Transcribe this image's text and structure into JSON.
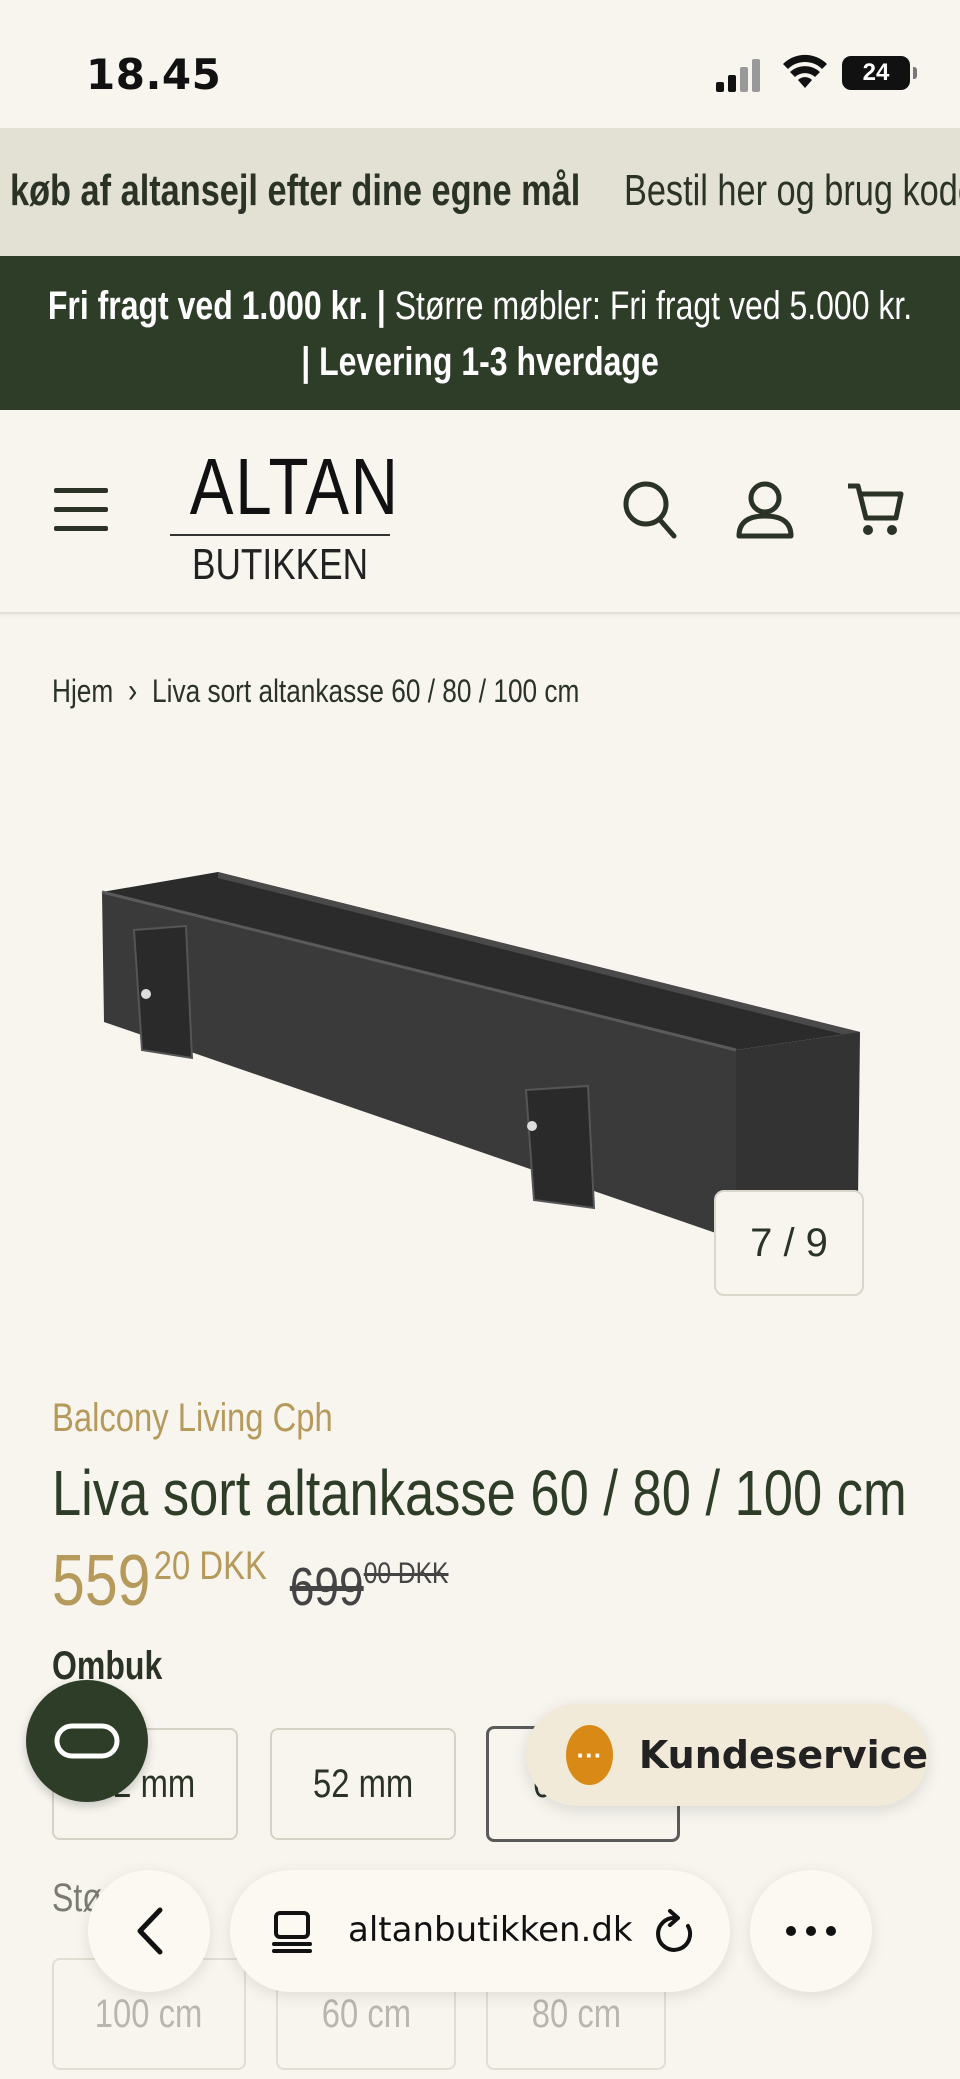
{
  "status_bar": {
    "time": "18.45",
    "battery": "24"
  },
  "announcement": {
    "text_bold": "køb af altansejl efter dine egne mål",
    "text_regular": "Bestil her og brug kode"
  },
  "shipping": {
    "part1": "Fri fragt ved 1.000 kr. |",
    "part2": " Større møbler: Fri fragt ved 5.000 kr.",
    "part3": "| Levering 1-3 hverdage"
  },
  "header": {
    "logo_top": "ALTAN",
    "logo_bottom": "BUTIKKEN",
    "icons": [
      "menu-icon",
      "search-icon",
      "account-icon",
      "cart-icon"
    ]
  },
  "breadcrumb": {
    "home": "Hjem",
    "current": "Liva sort altankasse 60 / 80 / 100 cm"
  },
  "gallery": {
    "counter": "7 / 9"
  },
  "product": {
    "vendor": "Balcony Living Cph",
    "title": "Liva sort altankasse 60 / 80 / 100 cm",
    "price_main": "559",
    "price_cents": "20 DKK",
    "old_main": "699",
    "old_cents": "00 DKK"
  },
  "options": {
    "ombuk_label": "Ombuk",
    "ombuk_values": [
      "42 mm",
      "52 mm",
      "62 mm"
    ],
    "size_label": "Størrelse",
    "size_values": [
      "100 cm",
      "60 cm",
      "80 cm"
    ]
  },
  "widgets": {
    "customer_service": "Kundeservice"
  },
  "browser": {
    "url": "altanbutikken.dk"
  },
  "colors": {
    "dark_green": "#2d3d28",
    "gold": "#b59a5b",
    "beige": "#f7f5ee",
    "chat_orange": "#d98a16"
  }
}
